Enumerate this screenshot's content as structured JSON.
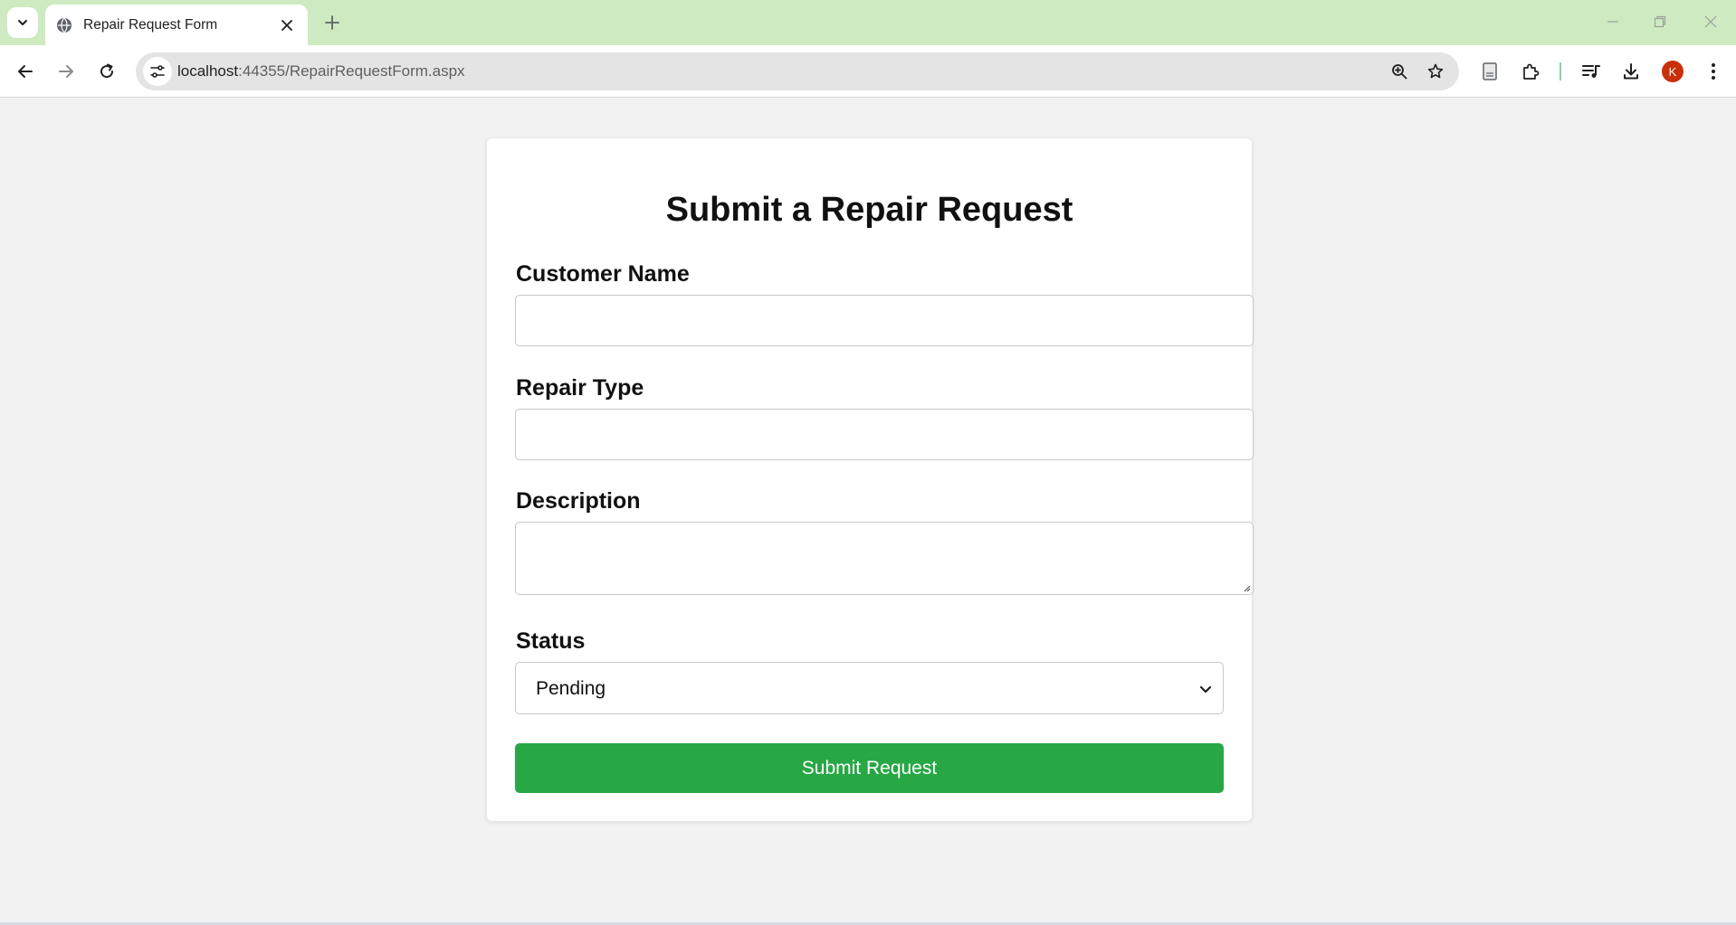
{
  "browser": {
    "tab_title": "Repair Request Form",
    "url_host": "localhost",
    "url_path": ":44355/RepairRequestForm.aspx",
    "profile_initial": "K",
    "icons": {
      "tab_search": "chevron-down-icon",
      "tab_favicon": "globe-icon",
      "tab_close": "close-icon",
      "new_tab": "plus-icon",
      "back": "arrow-left-icon",
      "forward": "arrow-right-icon",
      "reload": "reload-icon",
      "site_info": "tune-icon",
      "zoom": "zoom-in-icon",
      "bookmark": "star-icon",
      "reading_mode": "document-icon",
      "extensions": "puzzle-icon",
      "media": "playlist-icon",
      "downloads": "download-icon",
      "menu": "more-vertical-icon"
    },
    "colors": {
      "titlebar": "#cdeac0",
      "profile": "#c9300a"
    }
  },
  "form": {
    "title": "Submit a Repair Request",
    "customer_name": {
      "label": "Customer Name",
      "value": ""
    },
    "repair_type": {
      "label": "Repair Type",
      "value": ""
    },
    "description": {
      "label": "Description",
      "value": ""
    },
    "status": {
      "label": "Status",
      "selected": "Pending"
    },
    "submit_label": "Submit Request",
    "colors": {
      "submit": "#28a745"
    }
  }
}
